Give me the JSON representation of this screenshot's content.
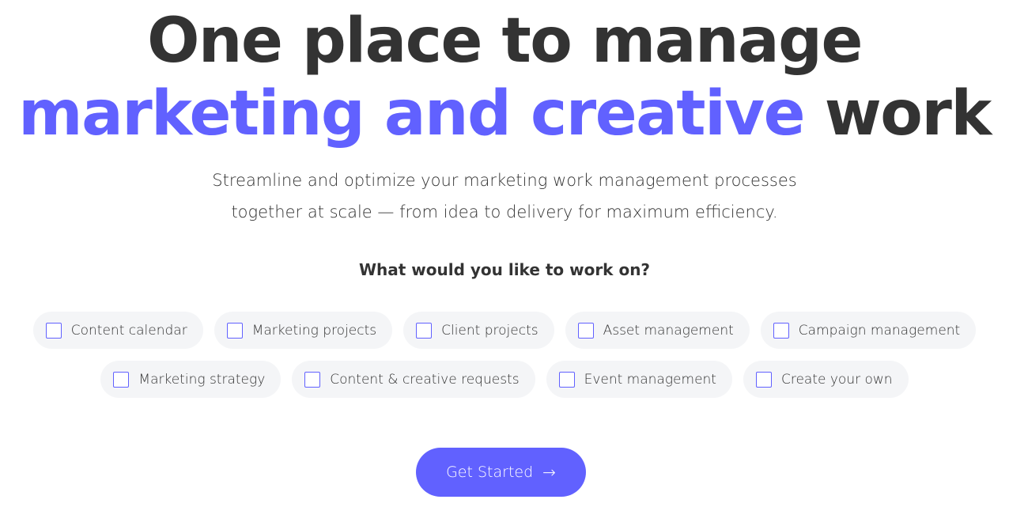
{
  "hero": {
    "title_line1": "One place to manage",
    "title_line2_accent": "marketing and creative",
    "title_line2_rest": " work",
    "accent_color": "#6161ff",
    "text_color": "#333333"
  },
  "subtitle": {
    "line1": "Streamline and optimize your marketing work management processes",
    "line2": "together at scale — from idea to delivery for maximum efficiency."
  },
  "question": "What would you like to work on?",
  "options_row1": [
    {
      "label": "Content calendar",
      "checked": false
    },
    {
      "label": "Marketing projects",
      "checked": false
    },
    {
      "label": "Client projects",
      "checked": false
    },
    {
      "label": "Asset management",
      "checked": false
    },
    {
      "label": "Campaign management",
      "checked": false
    }
  ],
  "options_row2": [
    {
      "label": "Marketing strategy",
      "checked": false
    },
    {
      "label": "Content & creative requests",
      "checked": false
    },
    {
      "label": "Event management",
      "checked": false
    },
    {
      "label": "Create your own",
      "checked": false
    }
  ],
  "cta": {
    "label": "Get Started",
    "icon": "arrow-right-icon",
    "icon_glyph": "→",
    "background_color": "#6161ff"
  }
}
